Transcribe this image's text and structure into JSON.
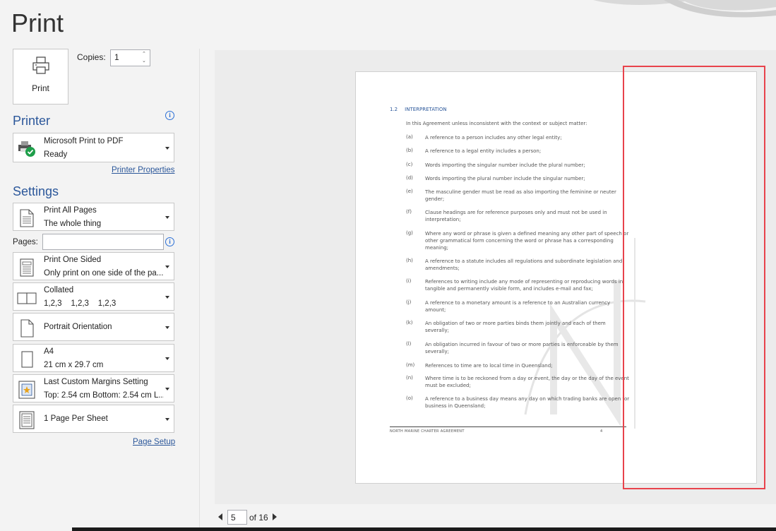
{
  "page_title": "Print",
  "print_button": {
    "label": "Print",
    "icon": "printer-icon"
  },
  "copies": {
    "label": "Copies:",
    "value": "1"
  },
  "printer": {
    "heading": "Printer",
    "name": "Microsoft Print to PDF",
    "status": "Ready",
    "properties_link": "Printer Properties"
  },
  "settings": {
    "heading": "Settings",
    "pages_label": "Pages:",
    "pages_value": "",
    "options": [
      {
        "line1": "Print All Pages",
        "line2": "The whole thing",
        "icon": "pages-icon"
      },
      {
        "line1": "Print One Sided",
        "line2": "Only print on one side of the pa...",
        "icon": "one-sided-icon"
      },
      {
        "line1": "Collated",
        "line2": "1,2,3    1,2,3    1,2,3",
        "icon": "collated-icon"
      },
      {
        "line1": "Portrait Orientation",
        "line2": "",
        "icon": "portrait-icon"
      },
      {
        "line1": "A4",
        "line2": "21 cm x 29.7 cm",
        "icon": "paper-size-icon"
      },
      {
        "line1": "Last Custom Margins Setting",
        "line2": "Top: 2.54 cm Bottom: 2.54 cm L...",
        "icon": "margins-icon"
      },
      {
        "line1": "1 Page Per Sheet",
        "line2": "",
        "icon": "pages-per-sheet-icon"
      }
    ],
    "page_setup_link": "Page Setup"
  },
  "preview": {
    "heading_num": "1.2",
    "heading": "INTERPRETATION",
    "intro": "In this Agreement unless inconsistent with the context or subject matter:",
    "items": [
      {
        "k": "(a)",
        "v": "A reference to a person includes any other legal entity;"
      },
      {
        "k": "(b)",
        "v": "A reference to a legal entity includes a person;"
      },
      {
        "k": "(c)",
        "v": "Words importing the singular number include the plural number;"
      },
      {
        "k": "(d)",
        "v": "Words importing the plural number include the singular number;"
      },
      {
        "k": "(e)",
        "v": "The masculine gender must be read as also importing the feminine or neuter gender;"
      },
      {
        "k": "(f)",
        "v": "Clause headings are for reference purposes only and must not be used in interpretation;"
      },
      {
        "k": "(g)",
        "v": "Where any word or phrase is given a defined meaning any other part of speech or other grammatical form concerning the word or phrase has a corresponding meaning;"
      },
      {
        "k": "(h)",
        "v": "A reference to a statute includes all regulations and subordinate legislation and amendments;"
      },
      {
        "k": "(i)",
        "v": "References to writing include any mode of representing or reproducing words in tangible and permanently visible form, and includes e-mail and fax;"
      },
      {
        "k": "(j)",
        "v": "A reference to a monetary amount is a reference to an Australian currency amount;"
      },
      {
        "k": "(k)",
        "v": "An obligation of two or more parties binds them jointly and each of them severally;"
      },
      {
        "k": "(l)",
        "v": "An obligation incurred in favour of two or more parties is enforceable by them severally;"
      },
      {
        "k": "(m)",
        "v": "References to time are to local time in Queensland;"
      },
      {
        "k": "(n)",
        "v": "Where time is to be reckoned from a day or event, the day or the day of the event must be excluded;"
      },
      {
        "k": "(o)",
        "v": "A reference to a business day means any day on which trading banks are open for business in Queensland;"
      }
    ],
    "footer_text": "NORTH MARINE CHARTER AGREEMENT",
    "footer_page": "4"
  },
  "navigation": {
    "current_page": "5",
    "of_text": "of 16"
  },
  "colors": {
    "accent": "#2b579a",
    "highlight": "#e8434c"
  }
}
